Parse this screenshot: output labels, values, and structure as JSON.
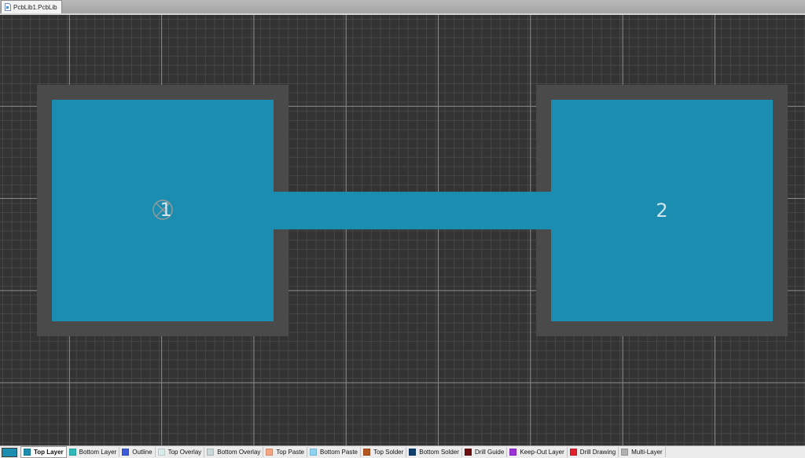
{
  "document": {
    "tab_label": "PcbLib1.PcbLib",
    "icon": "pcblib-document-icon"
  },
  "canvas": {
    "background": "#333333",
    "pad_color": "#1a8db0",
    "mask_color": "#4a4a4a",
    "pads": [
      {
        "label": "1"
      },
      {
        "label": "2"
      }
    ]
  },
  "layers": {
    "current_layer_color": "#1a8db0",
    "items": [
      {
        "label": "Top Layer",
        "color": "#1a8db0",
        "active": true,
        "name": "layer-tab-top-layer"
      },
      {
        "label": "Bottom Layer",
        "color": "#2eb8b8",
        "active": false,
        "name": "layer-tab-bottom-layer"
      },
      {
        "label": "Outline",
        "color": "#3b5bdb",
        "active": false,
        "name": "layer-tab-outline"
      },
      {
        "label": "Top Overlay",
        "color": "#d8ecec",
        "active": false,
        "name": "layer-tab-top-overlay"
      },
      {
        "label": "Bottom Overlay",
        "color": "#c8d8d8",
        "active": false,
        "name": "layer-tab-bottom-overlay"
      },
      {
        "label": "Top Paste",
        "color": "#f4a582",
        "active": false,
        "name": "layer-tab-top-paste"
      },
      {
        "label": "Bottom Paste",
        "color": "#8fd3f4",
        "active": false,
        "name": "layer-tab-bottom-paste"
      },
      {
        "label": "Top Solder",
        "color": "#b8561f",
        "active": false,
        "name": "layer-tab-top-solder"
      },
      {
        "label": "Bottom Solder",
        "color": "#0f3f6e",
        "active": false,
        "name": "layer-tab-bottom-solder"
      },
      {
        "label": "Drill Guide",
        "color": "#6b0f0f",
        "active": false,
        "name": "layer-tab-drill-guide"
      },
      {
        "label": "Keep-Out Layer",
        "color": "#9b30d9",
        "active": false,
        "name": "layer-tab-keep-out-layer"
      },
      {
        "label": "Drill Drawing",
        "color": "#e0202a",
        "active": false,
        "name": "layer-tab-drill-drawing"
      },
      {
        "label": "Multi-Layer",
        "color": "#b0b0b0",
        "active": false,
        "name": "layer-tab-multi-layer"
      }
    ]
  }
}
